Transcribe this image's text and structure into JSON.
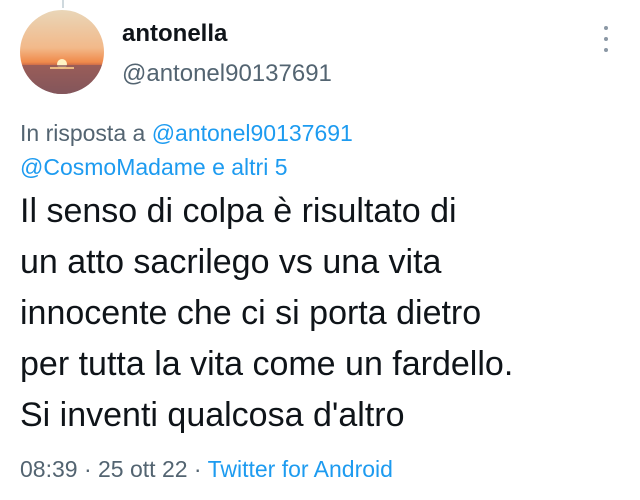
{
  "author": {
    "display_name": "antonella",
    "handle": "@antonel90137691"
  },
  "reply": {
    "prefix": "In risposta a ",
    "mention_1": "@antonel90137691",
    "mention_2": "@CosmoMadame e altri 5"
  },
  "tweet": {
    "lines": [
      "Il senso di colpa è risultato di",
      "un atto sacrilego vs una vita",
      "innocente che ci si porta dietro",
      "per tutta la vita come un fardello.",
      "Si inventi qualcosa d'altro"
    ]
  },
  "meta": {
    "time": "08:39",
    "separator": " · ",
    "date": "25 ott 22",
    "source": "Twitter for Android"
  },
  "icons": {
    "more": "more-vertical-icon",
    "avatar": "sunset-avatar"
  },
  "colors": {
    "link": "#1d9bf0",
    "secondary_text": "#536471",
    "primary_text": "#0f1419"
  }
}
